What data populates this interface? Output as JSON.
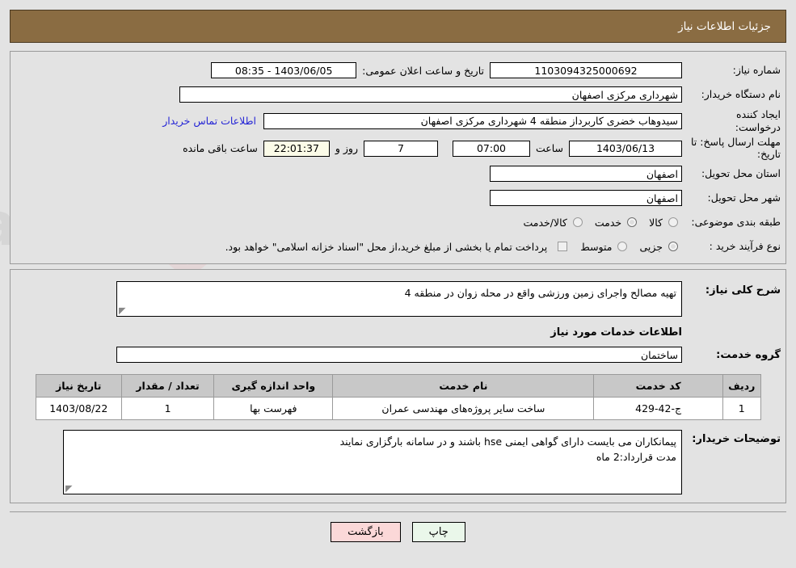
{
  "header": {
    "title": "جزئیات اطلاعات نیاز"
  },
  "form": {
    "need_number_label": "شماره نیاز:",
    "need_number_value": "1103094325000692",
    "public_announce_label": "تاریخ و ساعت اعلان عمومی:",
    "public_announce_value": "1403/06/05 - 08:35",
    "buyer_org_label": "نام دستگاه خریدار:",
    "buyer_org_value": "شهرداری مرکزی اصفهان",
    "creator_label": "ایجاد کننده درخواست:",
    "creator_value": "سیدوهاب خضری کاربرداز منطقه 4 شهرداری مرکزی اصفهان",
    "buyer_contact_link": "اطلاعات تماس خریدار",
    "deadline_label": "مهلت ارسال پاسخ: تا تاریخ:",
    "deadline_date": "1403/06/13",
    "time_label": "ساعت",
    "deadline_time": "07:00",
    "days_value": "7",
    "days_label": "روز و",
    "countdown_value": "22:01:37",
    "remaining_label": "ساعت باقی مانده",
    "province_label": "استان محل تحویل:",
    "province_value": "اصفهان",
    "city_label": "شهر محل تحویل:",
    "city_value": "اصفهان",
    "category_label": "طبقه بندی موضوعی:",
    "category_options": [
      "کالا",
      "خدمت",
      "کالا/خدمت"
    ],
    "category_selected": "خدمت",
    "purchase_type_label": "نوع فرآیند خرید :",
    "purchase_options": [
      "جزیی",
      "متوسط"
    ],
    "purchase_selected": "جزیی",
    "treasury_note": "پرداخت تمام یا بخشی از مبلغ خرید،از محل \"اسناد خزانه اسلامی\" خواهد بود."
  },
  "middle": {
    "description_label": "شرح کلی نیاز:",
    "description_value": "تهیه مصالح واجرای زمین ورزشی واقع در محله زوان در منطقه 4",
    "services_section_title": "اطلاعات خدمات مورد نیاز",
    "service_group_label": "گروه خدمت:",
    "service_group_value": "ساختمان"
  },
  "table": {
    "headers": [
      "ردیف",
      "کد خدمت",
      "نام خدمت",
      "واحد اندازه گیری",
      "تعداد / مقدار",
      "تاریخ نیاز"
    ],
    "rows": [
      {
        "radif": "1",
        "code": "ج-42-429",
        "name": "ساخت سایر پروژه‌های مهندسی عمران",
        "unit": "فهرست بها",
        "qty": "1",
        "date": "1403/08/22"
      }
    ]
  },
  "notes": {
    "label": "توضیحات خریدار:",
    "value": "پیمانکاران می بایست دارای گواهی ایمنی hse باشند و در سامانه بارگزاری نمایند\nمدت قرارداد:2 ماه"
  },
  "footer": {
    "print_label": "چاپ",
    "back_label": "بازگشت"
  },
  "colors": {
    "header_bar": "#8a6c42",
    "page_bg": "#e3e3e3",
    "link": "#2525d6",
    "print_btn": "#eaf7ea",
    "back_btn": "#fbd8d8",
    "countdown_bg": "#fbfbe8"
  }
}
